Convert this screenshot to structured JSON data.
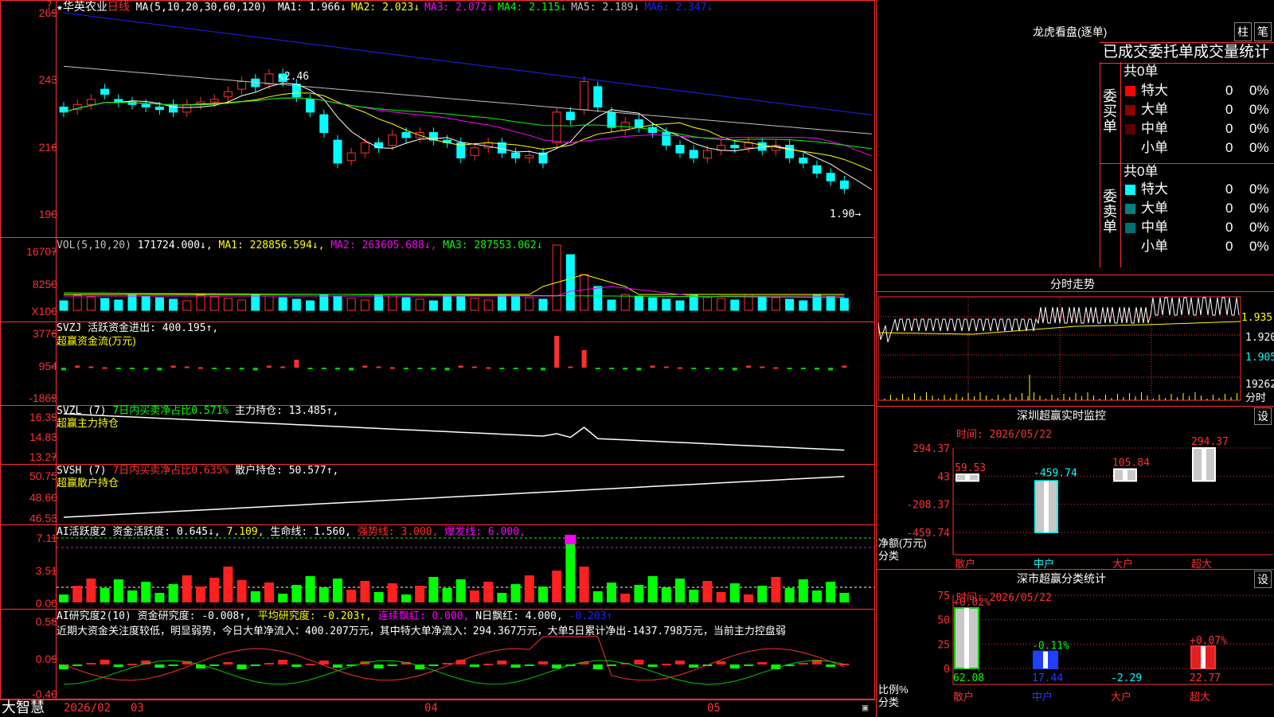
{
  "main": {
    "star": "★",
    "stock_name": "华英农业",
    "period": "日线",
    "ma_title": "MA(5,10,20,30,60,120)",
    "ma": [
      {
        "label": "MA1:",
        "value": "1.966↓",
        "color": "#ffffff"
      },
      {
        "label": "MA2:",
        "value": "2.023↓",
        "color": "#ffff00"
      },
      {
        "label": "MA3:",
        "value": "2.072↓",
        "color": "#ff00ff"
      },
      {
        "label": "MA4:",
        "value": "2.115↓",
        "color": "#00ff00"
      },
      {
        "label": "MA5:",
        "value": "2.189↓",
        "color": "#c0c0c0"
      },
      {
        "label": "MA6:",
        "value": "2.347↓",
        "color": "#2020ff"
      }
    ],
    "y_labels": [
      "269",
      "243",
      "216",
      "190"
    ],
    "high_marker": "2.46",
    "low_marker": "1.90"
  },
  "vol": {
    "title": "VOL(5,10,20)",
    "value": "171724.000↓,",
    "ma1": "MA1: 228856.594↓,",
    "ma2": "MA2: 263605.688↓,",
    "ma3": "MA3: 287553.062↓",
    "y_labels": [
      "16707",
      "8250",
      "X100"
    ]
  },
  "svzj": {
    "title": "SVZJ  活跃资金进出: 400.195↑,",
    "subtitle": "超赢资金流(万元)",
    "y_labels": [
      "3776",
      "954",
      "-1869"
    ]
  },
  "svzl": {
    "title_a": "SVZL (7)",
    "title_b": "7日内买卖净占比0.571%",
    "title_c": "主力持仓: 13.485↑,",
    "subtitle": "超赢主力持仓",
    "y_labels": [
      "16.39",
      "14.83",
      "13.27"
    ]
  },
  "svsh": {
    "title_a": "SVSH (7)",
    "title_b": "7日内买卖净占比0.635%",
    "title_c": "散户持仓: 50.577↑,",
    "subtitle": "超赢散户持仓",
    "y_labels": [
      "50.75",
      "48.60",
      "46.53"
    ]
  },
  "ai_active": {
    "title_a": "AI活跃度2 资金活跃度: 0.645↓,",
    "title_b": "7.109,",
    "title_c": "生命线: 1.560,",
    "title_d": "强势线: 3.000,",
    "title_e": "爆发线: 6.000,",
    "y_labels": [
      "7.11",
      "3.51",
      "0.00"
    ]
  },
  "ai_research": {
    "title_a": "AI研究度2(10) 资金研究度: -0.008↑,",
    "title_b": "平均研究度: -0.203↑,",
    "title_c": "连续飘红: 0.000,",
    "title_d": "N日飘红: 4.000,",
    "title_e": "-0.203↑",
    "comment": "近期大资金关注度较低，明显弱势，今日大单净流入：400.207万元，其中特大单净流入：294.367万元，大单5日累计净出-1437.798万元，当前主力控盘弱",
    "y_labels": [
      "0.58",
      "0.09",
      "-0.40"
    ]
  },
  "bottom": {
    "brand": "大智慧",
    "dates": [
      "2026/02",
      "03",
      "04",
      "05"
    ]
  },
  "dragon": {
    "title": "龙虎看盘(逐单)",
    "btn_a": "柱",
    "btn_b": "笔",
    "header": "已成交委托单成交量统计",
    "buy_side": "委买单",
    "sell_side": "委卖单",
    "buy_total": "共0单",
    "sell_total": "共0单",
    "buy_rows": [
      {
        "name": "特大",
        "count": "0",
        "pct": "0%",
        "color": "#ff0000"
      },
      {
        "name": "大单",
        "count": "0",
        "pct": "0%",
        "color": "#8b0000"
      },
      {
        "name": "中单",
        "count": "0",
        "pct": "0%",
        "color": "#5a0000"
      },
      {
        "name": "小单",
        "count": "0",
        "pct": "0%",
        "color": "#000000"
      }
    ],
    "sell_rows": [
      {
        "name": "特大",
        "count": "0",
        "pct": "0%",
        "color": "#00ffff"
      },
      {
        "name": "大单",
        "count": "0",
        "pct": "0%",
        "color": "#008080"
      },
      {
        "name": "中单",
        "count": "0",
        "pct": "0%",
        "color": "#007070"
      },
      {
        "name": "小单",
        "count": "0",
        "pct": "0%",
        "color": "#000000"
      }
    ]
  },
  "intraday": {
    "title": "分时走势",
    "prices": [
      "1.935",
      "1.920",
      "1.905"
    ],
    "volume": "19262",
    "volume_unit": "分时"
  },
  "sz_monitor": {
    "title": "深圳超赢实时监控",
    "setting": "设",
    "time_label": "时间: 2026/05/22",
    "y_labels": [
      "294.37",
      "43",
      "-208.37",
      "-459.74"
    ],
    "axis_label_a": "净额(万元)",
    "axis_label_b": "分类",
    "categories": [
      "散户",
      "中户",
      "大户",
      "超大"
    ],
    "values": [
      59.53,
      -459.74,
      105.84,
      294.37
    ],
    "value_labels": [
      "59.53",
      "-459.74",
      "105.84",
      "294.37"
    ]
  },
  "sz_class": {
    "title": "深市超赢分类统计",
    "setting": "设",
    "time_label": "时间: 2026/05/22",
    "y_labels": [
      "75",
      "50",
      "25",
      "0"
    ],
    "axis_label_a": "比例%",
    "axis_label_b": "分类",
    "categories": [
      "散户",
      "中户",
      "大户",
      "超大"
    ],
    "top_labels": [
      "+0.02%",
      "-0.11%",
      "",
      "+0.07%"
    ],
    "bottom_values": [
      "62.08",
      "17.44",
      "-2.29",
      "22.77"
    ],
    "bar_values": [
      62.08,
      17.44,
      0,
      22.77
    ]
  }
}
